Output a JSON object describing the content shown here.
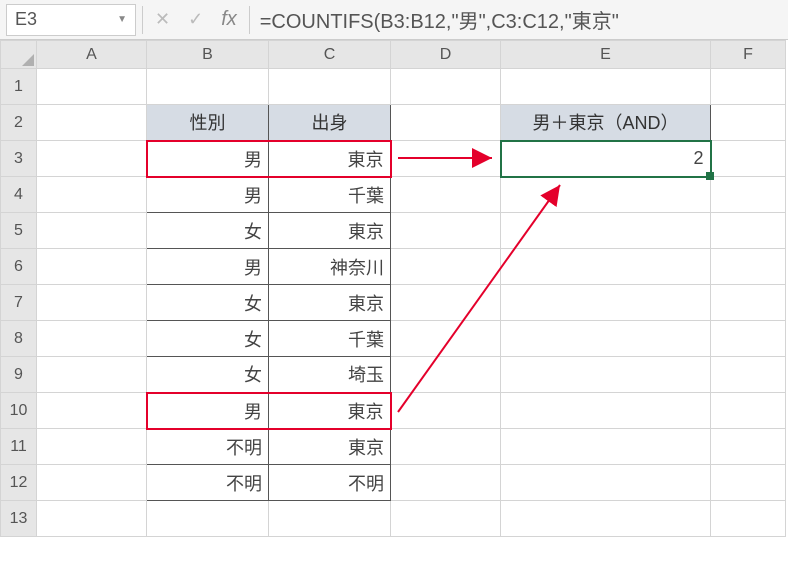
{
  "name_box": {
    "value": "E3"
  },
  "formula_bar": {
    "formula": "=COUNTIFS(B3:B12,\"男\",C3:C12,\"東京\""
  },
  "columns": [
    "A",
    "B",
    "C",
    "D",
    "E",
    "F"
  ],
  "rows": [
    "1",
    "2",
    "3",
    "4",
    "5",
    "6",
    "7",
    "8",
    "9",
    "10",
    "11",
    "12",
    "13"
  ],
  "headers": {
    "B2": "性別",
    "C2": "出身",
    "E2": "男＋東京（AND）"
  },
  "result": {
    "E3": "2"
  },
  "data": {
    "B": [
      "男",
      "男",
      "女",
      "男",
      "女",
      "女",
      "女",
      "男",
      "不明",
      "不明"
    ],
    "C": [
      "東京",
      "千葉",
      "東京",
      "神奈川",
      "東京",
      "千葉",
      "埼玉",
      "東京",
      "東京",
      "不明"
    ]
  }
}
